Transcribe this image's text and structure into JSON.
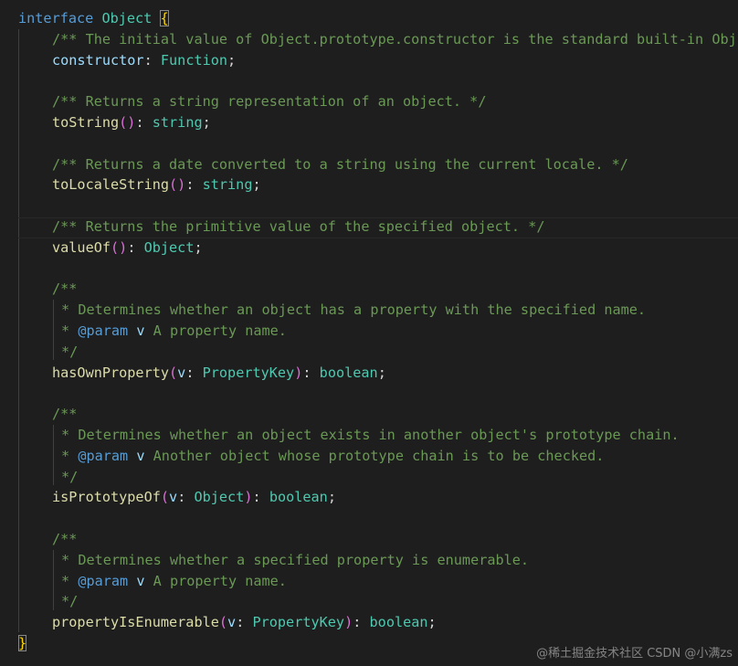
{
  "code": {
    "interface_keyword": "interface",
    "interface_name": "Object",
    "open_brace": "{",
    "close_brace": "}",
    "comment_constructor": "/** The initial value of Object.prototype.constructor is the standard built-in Obj",
    "constructor_name": "constructor",
    "constructor_type": "Function",
    "comment_tostring": "/** Returns a string representation of an object. */",
    "tostring_name": "toString",
    "tostring_type": "string",
    "comment_tolocalestring": "/** Returns a date converted to a string using the current locale. */",
    "tolocalestring_name": "toLocaleString",
    "tolocalestring_type": "string",
    "comment_valueof": "/** Returns the primitive value of the specified object. */",
    "valueof_name": "valueOf",
    "valueof_type": "Object",
    "doc_open": "/**",
    "doc_close": "*/",
    "doc_star": "*",
    "param_tag": "@param",
    "param_v": "v",
    "hasown_desc": "Determines whether an object has a property with the specified name.",
    "hasown_param_desc": "A property name.",
    "hasown_name": "hasOwnProperty",
    "hasown_arg": "v",
    "hasown_arg_type": "PropertyKey",
    "hasown_type": "boolean",
    "isproto_desc": "Determines whether an object exists in another object's prototype chain.",
    "isproto_param_desc": "Another object whose prototype chain is to be checked.",
    "isproto_name": "isPrototypeOf",
    "isproto_arg": "v",
    "isproto_arg_type": "Object",
    "isproto_type": "boolean",
    "propenum_desc": "Determines whether a specified property is enumerable.",
    "propenum_param_desc": "A property name.",
    "propenum_name": "propertyIsEnumerable",
    "propenum_arg": "v",
    "propenum_arg_type": "PropertyKey",
    "propenum_type": "boolean"
  },
  "watermark": "@稀土掘金技术社区 CSDN @小满zs"
}
